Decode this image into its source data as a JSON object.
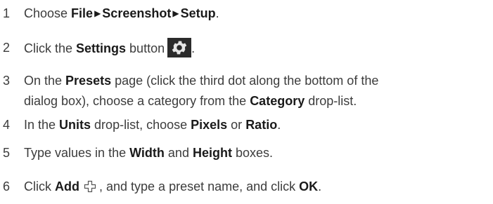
{
  "steps": [
    {
      "num": "1",
      "pre": "Choose ",
      "a": "File",
      "b": "Screenshot",
      "c": "Setup",
      "post": "."
    },
    {
      "num": "2",
      "pre": "Click the ",
      "bold": "Settings",
      "post": " button"
    },
    {
      "num": "3",
      "pre": "On the ",
      "bold1": "Presets",
      "mid1": " page (click the third dot along the bottom of the",
      "line2a": "dialog box), choose a category from the ",
      "bold2": "Category",
      "post": " drop-list."
    },
    {
      "num": "4",
      "pre": "In the ",
      "bold1": "Units",
      "mid1": " drop-list, choose ",
      "bold2": "Pixels",
      "mid2": " or ",
      "bold3": "Ratio",
      "post": "."
    },
    {
      "num": "5",
      "pre": "Type values in the ",
      "bold1": "Width",
      "mid1": " and ",
      "bold2": "Height",
      "post": " boxes."
    },
    {
      "num": "6",
      "pre": "Click ",
      "bold1": "Add",
      "mid1": ", and type a preset name, and click ",
      "bold2": "OK",
      "post": "."
    }
  ],
  "icons": {
    "arrow": "▶",
    "settings": "gear-icon",
    "add": "plus-icon"
  }
}
